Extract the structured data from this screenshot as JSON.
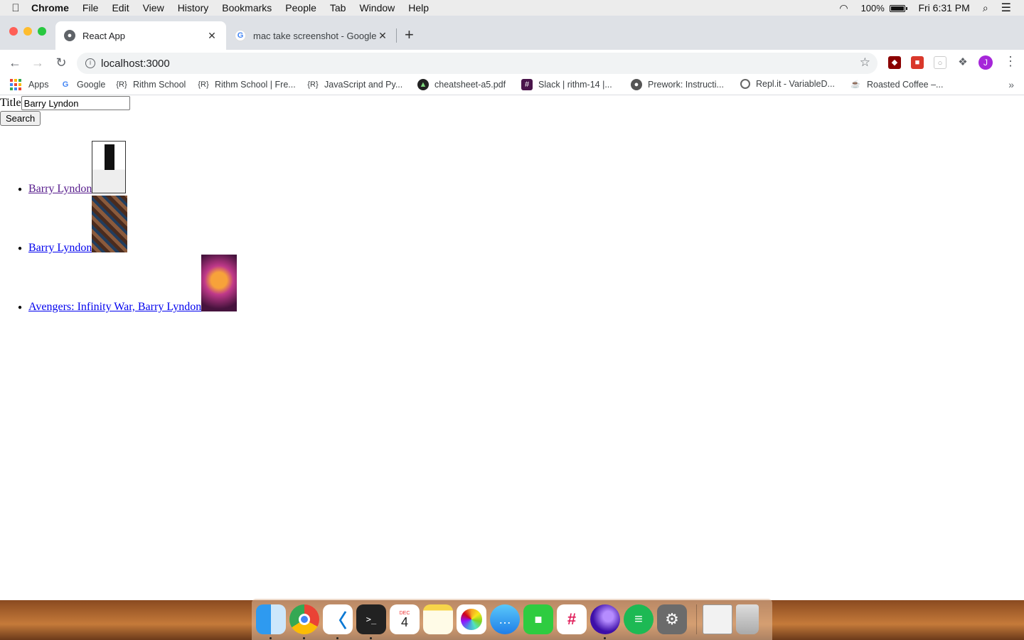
{
  "menubar": {
    "app": "Chrome",
    "items": [
      "File",
      "Edit",
      "View",
      "History",
      "Bookmarks",
      "People",
      "Tab",
      "Window",
      "Help"
    ],
    "battery": "100%",
    "clock": "Fri 6:31 PM"
  },
  "tabs": [
    {
      "title": "React App",
      "active": true
    },
    {
      "title": "mac take screenshot - Google",
      "active": false
    }
  ],
  "toolbar": {
    "url": "localhost:3000",
    "avatar_letter": "J"
  },
  "bookmarks": [
    {
      "label": "Apps",
      "icon": "apps-grid-icon"
    },
    {
      "label": "Google",
      "icon": "google-icon"
    },
    {
      "label": "Rithm School",
      "icon": "rithm-icon"
    },
    {
      "label": "Rithm School | Fre...",
      "icon": "rithm-icon"
    },
    {
      "label": "JavaScript and Py...",
      "icon": "rithm-icon"
    },
    {
      "label": "cheatsheet-a5.pdf",
      "icon": "pdf-icon"
    },
    {
      "label": "Slack | rithm-14 |...",
      "icon": "slack-icon"
    },
    {
      "label": "Prework: Instructi...",
      "icon": "globe-icon"
    },
    {
      "label": "Repl.it - VariableD...",
      "icon": "replit-icon"
    },
    {
      "label": "Roasted Coffee –...",
      "icon": "coffee-icon"
    }
  ],
  "form": {
    "label": "Title",
    "value": "Barry Lyndon",
    "button": "Search"
  },
  "results": [
    {
      "title": "Barry Lyndon",
      "visited": true
    },
    {
      "title": "Barry Lyndon",
      "visited": false
    },
    {
      "title": "Avengers: Infinity War, Barry Lyndon",
      "visited": false
    }
  ],
  "dock": {
    "calendar_month": "DEC",
    "calendar_day": "4"
  }
}
